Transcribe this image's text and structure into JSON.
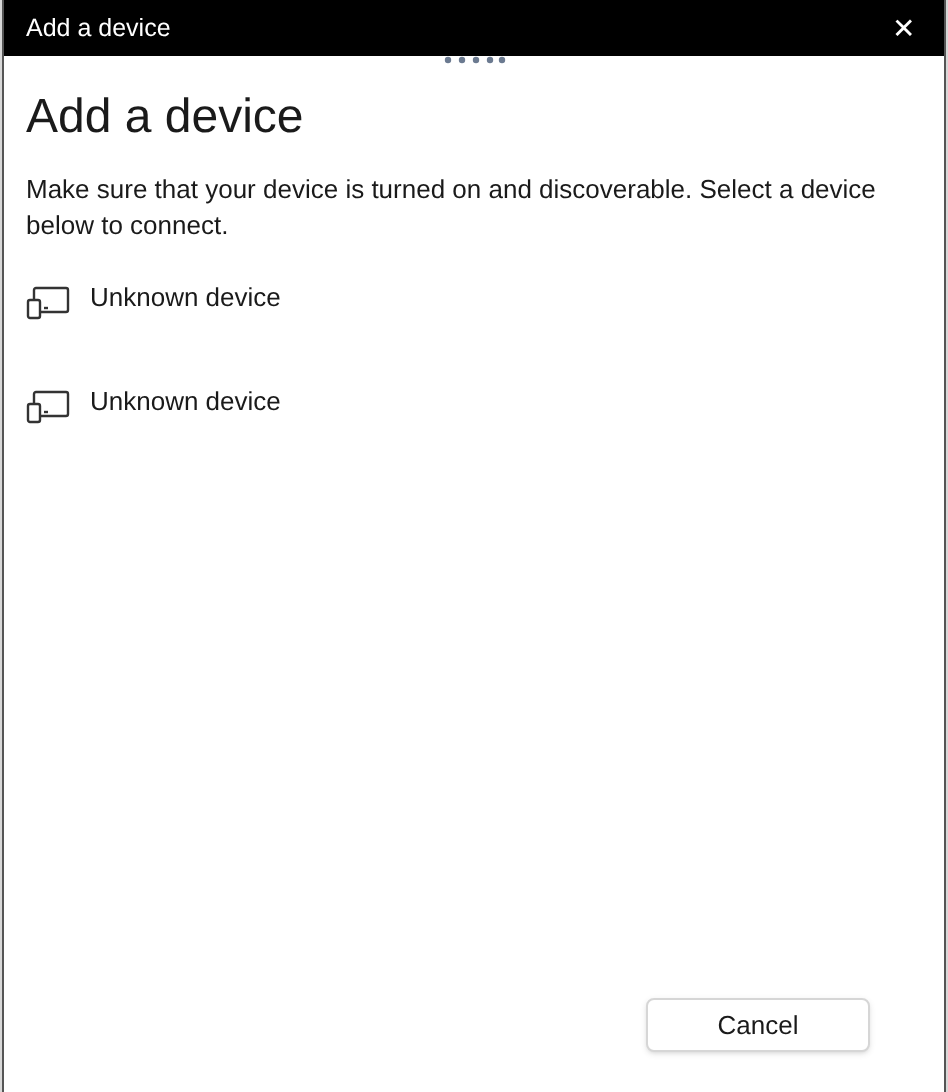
{
  "window": {
    "title": "Add a device",
    "close": "✕"
  },
  "heading": "Add a device",
  "description": "Make sure that your device is turned on and discoverable. Select a device below to connect.",
  "devices": [
    {
      "name": "Unknown device"
    },
    {
      "name": "Unknown device"
    }
  ],
  "buttons": [
    "Cancel"
  ]
}
